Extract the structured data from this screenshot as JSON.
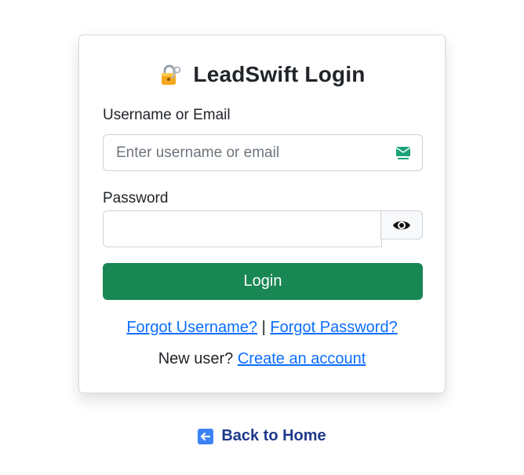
{
  "login_card": {
    "title": "LeadSwift Login",
    "title_icon": "lock-with-key-icon",
    "username_label": "Username or Email",
    "username_placeholder": "Enter username or email",
    "username_value": "",
    "username_field_icon": "tempmail-extension-icon",
    "password_label": "Password",
    "password_value": "",
    "password_toggle_icon": "eye-icon",
    "login_button_label": "Login",
    "forgot_username_link": "Forgot Username?",
    "separator": "|",
    "forgot_password_link": "Forgot Password?",
    "new_user_text": "New user?",
    "create_account_link": "Create an account"
  },
  "footer": {
    "back_icon": "left-arrow-icon",
    "back_link": "Back to Home"
  },
  "colors": {
    "primary_button": "#198754",
    "link": "#0d6efd",
    "back_link": "#1e3a8a"
  }
}
